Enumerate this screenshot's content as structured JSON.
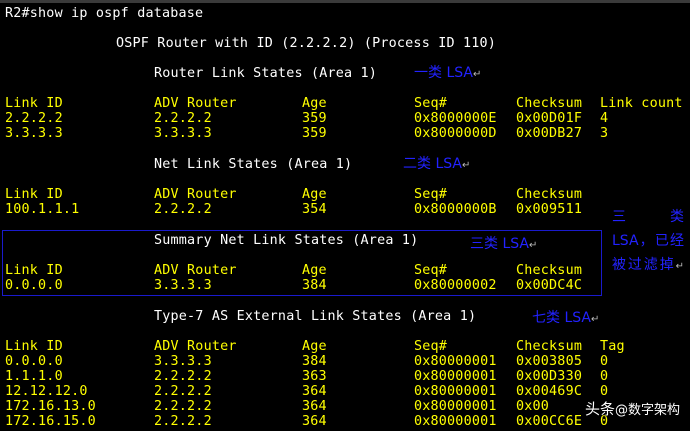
{
  "terminal": {
    "command": "R2#show ip ospf database",
    "banner": "OSPF Router with ID (2.2.2.2) (Process ID 110)",
    "sections": {
      "router": {
        "title": "Router Link States (Area 1)",
        "annotation": "一类 LSA",
        "headers": {
          "link_id": "Link ID",
          "adv_router": "ADV Router",
          "age": "Age",
          "seq": "Seq#",
          "checksum": "Checksum",
          "extra": "Link count"
        },
        "rows": [
          {
            "link_id": "2.2.2.2",
            "adv_router": "2.2.2.2",
            "age": "359",
            "seq": "0x8000000E",
            "checksum": "0x00D01F",
            "extra": "4"
          },
          {
            "link_id": "3.3.3.3",
            "adv_router": "3.3.3.3",
            "age": "359",
            "seq": "0x8000000D",
            "checksum": "0x00DB27",
            "extra": "3"
          }
        ]
      },
      "net": {
        "title": "Net Link States (Area 1)",
        "annotation": "二类 LSA",
        "headers": {
          "link_id": "Link ID",
          "adv_router": "ADV Router",
          "age": "Age",
          "seq": "Seq#",
          "checksum": "Checksum"
        },
        "rows": [
          {
            "link_id": "100.1.1.1",
            "adv_router": "2.2.2.2",
            "age": "354",
            "seq": "0x8000000B",
            "checksum": "0x009511"
          }
        ]
      },
      "summary": {
        "title": "Summary Net Link States (Area 1)",
        "annotation": "三类 LSA",
        "side_note": "三 类 LSA，已经被过滤掉",
        "headers": {
          "link_id": "Link ID",
          "adv_router": "ADV Router",
          "age": "Age",
          "seq": "Seq#",
          "checksum": "Checksum"
        },
        "rows": [
          {
            "link_id": "0.0.0.0",
            "adv_router": "3.3.3.3",
            "age": "384",
            "seq": "0x80000002",
            "checksum": "0x00DC4C"
          }
        ]
      },
      "type7": {
        "title": "Type-7 AS External Link States (Area 1)",
        "annotation": "七类 LSA",
        "headers": {
          "link_id": "Link ID",
          "adv_router": "ADV Router",
          "age": "Age",
          "seq": "Seq#",
          "checksum": "Checksum",
          "extra": "Tag"
        },
        "rows": [
          {
            "link_id": "0.0.0.0",
            "adv_router": "3.3.3.3",
            "age": "384",
            "seq": "0x80000001",
            "checksum": "0x003805",
            "extra": "0"
          },
          {
            "link_id": "1.1.1.0",
            "adv_router": "2.2.2.2",
            "age": "363",
            "seq": "0x80000001",
            "checksum": "0x00D330",
            "extra": "0"
          },
          {
            "link_id": "12.12.12.0",
            "adv_router": "2.2.2.2",
            "age": "364",
            "seq": "0x80000001",
            "checksum": "0x00469C",
            "extra": "0"
          },
          {
            "link_id": "172.16.13.0",
            "adv_router": "2.2.2.2",
            "age": "364",
            "seq": "0x80000001",
            "checksum": "0x00",
            "extra": ""
          },
          {
            "link_id": "172.16.15.0",
            "adv_router": "2.2.2.2",
            "age": "364",
            "seq": "0x80000001",
            "checksum": "0x00CC6E",
            "extra": "0"
          }
        ]
      }
    }
  },
  "watermark": {
    "prefix": "头条",
    "handle": "@数字架构"
  },
  "colors": {
    "background": "#000000",
    "terminal_text": "#ffffff",
    "highlight_text": "#ffff00",
    "annotation": "#2222ff",
    "box_border": "#1a1acc"
  }
}
